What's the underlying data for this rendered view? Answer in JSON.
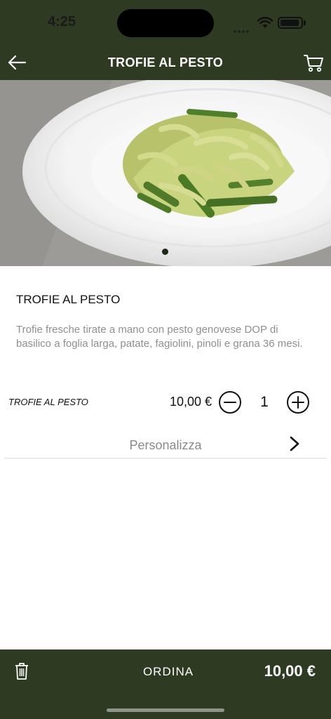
{
  "status_bar": {
    "time": "4:25"
  },
  "nav": {
    "title": "TROFIE AL PESTO"
  },
  "product": {
    "title": "TROFIE AL PESTO",
    "description": "Trofie fresche tirate a mano con pesto genovese DOP di basilico a foglia larga, patate, fagiolini, pinoli e grana 36 mesi."
  },
  "carousel": {
    "pages": 1,
    "active_page": 1
  },
  "line_item": {
    "name": "TROFIE AL PESTO",
    "price": "10,00 €",
    "quantity": "1"
  },
  "customize": {
    "label": "Personalizza"
  },
  "footer": {
    "order_label": "ORDINA",
    "total": "10,00 €"
  },
  "colors": {
    "brand": "#2f3a23",
    "text": "#111111",
    "muted": "#8f8f8f"
  },
  "icons": [
    "back-arrow-icon",
    "cart-icon",
    "minus-circle-icon",
    "plus-circle-icon",
    "chevron-right-icon",
    "trash-icon",
    "wifi-icon",
    "battery-icon"
  ]
}
